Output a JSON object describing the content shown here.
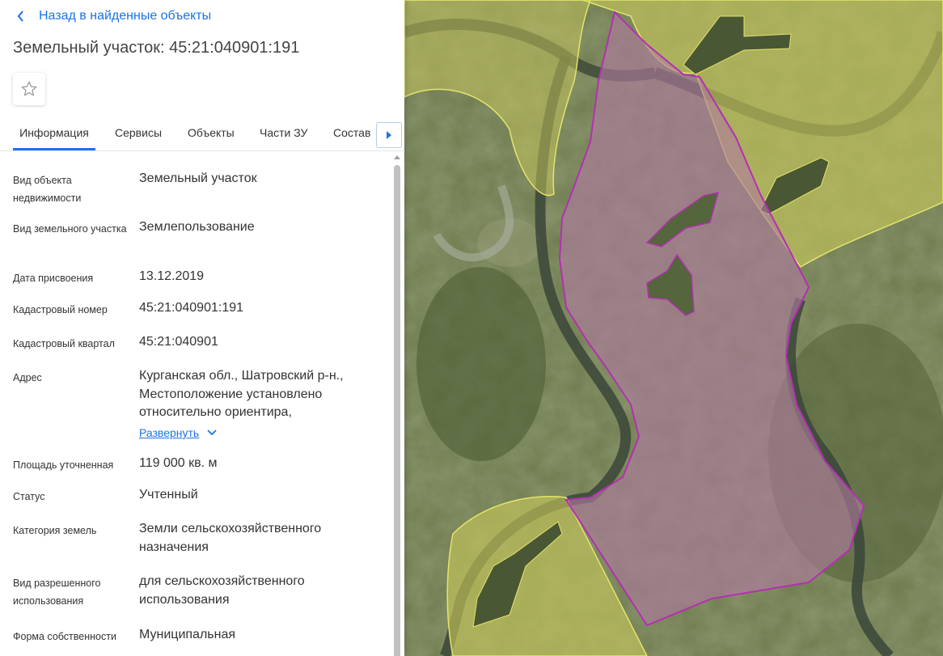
{
  "back": {
    "label": "Назад в найденные объекты"
  },
  "title": "Земельный участок: 45:21:040901:191",
  "tabs": [
    {
      "label": "Информация",
      "active": true
    },
    {
      "label": "Сервисы"
    },
    {
      "label": "Объекты"
    },
    {
      "label": "Части ЗУ"
    },
    {
      "label": "Состав"
    }
  ],
  "info": {
    "object_type": {
      "label": "Вид объекта недвижимости",
      "value": "Земельный участок"
    },
    "land_type": {
      "label": "Вид земельного участка",
      "value": "Землепользование"
    },
    "assign_date": {
      "label": "Дата присвоения",
      "value": "13.12.2019"
    },
    "cadastral_number": {
      "label": "Кадастровый номер",
      "value": "45:21:040901:191"
    },
    "cadastral_block": {
      "label": "Кадастровый квартал",
      "value": "45:21:040901"
    },
    "address": {
      "label": "Адрес",
      "value": "Курганская обл., Шатровский р-н., Местоположение установлено относительно ориентира,",
      "expand_label": "Развернуть"
    },
    "area": {
      "label": "Площадь уточненная",
      "value": "119 000 кв. м"
    },
    "status": {
      "label": "Статус",
      "value": "Учтенный"
    },
    "land_category": {
      "label": "Категория земель",
      "value": "Земли сельскохозяйственного назначения"
    },
    "permitted_use": {
      "label": "Вид разрешенного использования",
      "value": "для сельскохозяйственного использования"
    },
    "ownership": {
      "label": "Форма собственности",
      "value": "Муниципальная"
    }
  },
  "colors": {
    "accent": "#1a73e8",
    "parcel_fill": "#b07aa0",
    "parcel_stroke": "#b52fb4",
    "neighbor_fill": "#c8c85a",
    "neighbor_stroke": "#e4e46a",
    "imagery": "#6c7a4a"
  },
  "icons": {
    "back": "chevron-left-icon",
    "favorite": "star-outline-icon",
    "expand": "chevron-down-icon",
    "tabs_scroll": "triangle-right-icon"
  }
}
